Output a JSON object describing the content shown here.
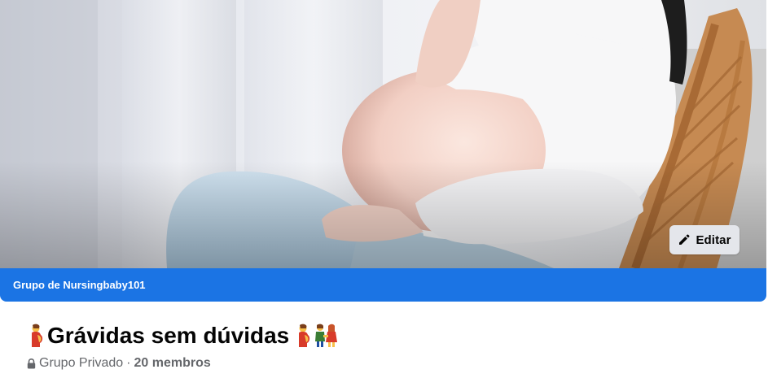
{
  "cover": {
    "image_icon": "pregnant-woman-cover-photo",
    "edit_label": "Editar",
    "edit_icon": "pencil-icon"
  },
  "owner_bar": {
    "text": "Grupo de Nursingbaby101",
    "color": "#1b74e4"
  },
  "group": {
    "title": "Grávidas sem dúvidas",
    "title_prefix_icon": "pregnant-woman-emoji",
    "title_suffix_icons": [
      "pregnant-woman-emoji",
      "couple-emoji"
    ],
    "privacy_icon": "lock-icon",
    "privacy": "Grupo Privado",
    "separator": "·",
    "members": "20 membros"
  },
  "colors": {
    "primary": "#1b74e4",
    "text": "#050505",
    "secondary_text": "#65676b",
    "button_bg": "#e4e6eb"
  }
}
